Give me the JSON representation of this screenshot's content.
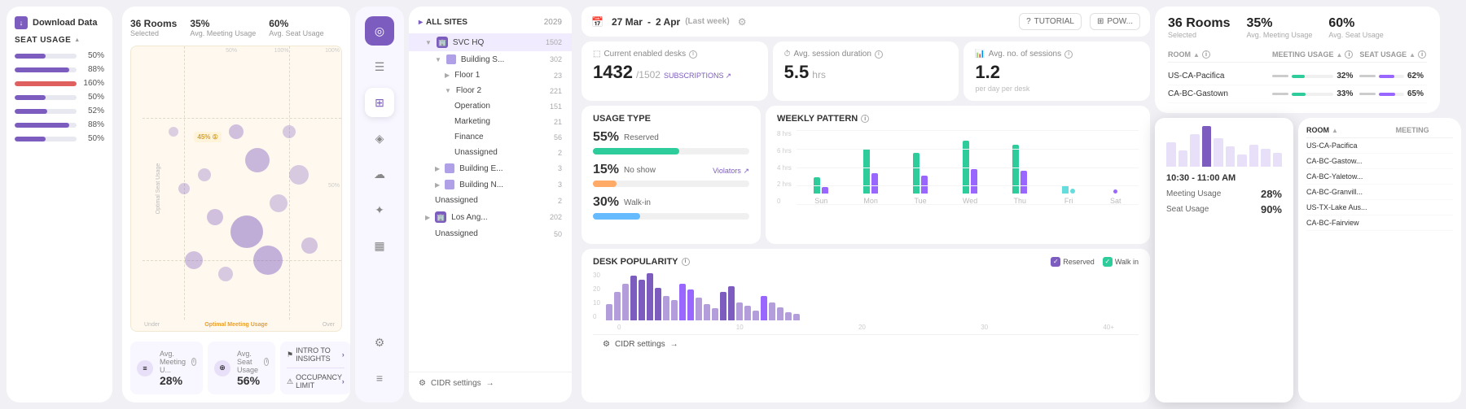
{
  "left_panel": {
    "download_label": "Download Data",
    "seat_usage_label": "SEAT USAGE",
    "usage_rows": [
      {
        "pct": "50%",
        "fill": 50
      },
      {
        "pct": "88%",
        "fill": 88
      },
      {
        "pct": "160%",
        "fill": 100
      },
      {
        "pct": "50%",
        "fill": 50
      },
      {
        "pct": "52%",
        "fill": 52
      },
      {
        "pct": "88%",
        "fill": 88
      },
      {
        "pct": "50%",
        "fill": 50
      }
    ],
    "avg_meeting_label": "Avg. Meeting U...",
    "avg_meeting_value": "28%",
    "avg_seat_label": "Avg. Seat Usage",
    "avg_seat_value": "56%",
    "intro_label": "INTRO TO INSIGHTS",
    "occupancy_label": "OCCUPANCY LIMIT",
    "chart_header": {
      "rooms": "36 Rooms",
      "room_sublabel": "Selected",
      "avg_meeting": "35%",
      "avg_meeting_label": "Avg. Meeting Usage",
      "avg_seat": "60%",
      "avg_seat_label": "Avg. Seat Usage"
    }
  },
  "sidebar": {
    "icons": [
      "◎",
      "☰",
      "⊞",
      "♦",
      "☁",
      "⚙",
      "✦",
      "☰",
      "⚙",
      "≡"
    ]
  },
  "tree": {
    "header": "ALL SITES",
    "year": "2029",
    "items": [
      {
        "name": "SVC HQ",
        "count": "1502",
        "level": 1,
        "expanded": true,
        "active": true
      },
      {
        "name": "Building S...",
        "count": "302",
        "level": 2,
        "expanded": true
      },
      {
        "name": "Floor 1",
        "count": "23",
        "level": 3
      },
      {
        "name": "Floor 2",
        "count": "221",
        "level": 3,
        "expanded": true
      },
      {
        "name": "Operation",
        "count": "151",
        "level": 4
      },
      {
        "name": "Marketing",
        "count": "21",
        "level": 4
      },
      {
        "name": "Finance",
        "count": "56",
        "level": 4
      },
      {
        "name": "Unassigned",
        "count": "2",
        "level": 4
      },
      {
        "name": "Building E...",
        "count": "3",
        "level": 2
      },
      {
        "name": "Building N...",
        "count": "3",
        "level": 2
      },
      {
        "name": "Unassigned",
        "count": "2",
        "level": 2
      },
      {
        "name": "Los Ang...",
        "count": "202",
        "level": 1,
        "expanded": false
      },
      {
        "name": "Unassigned",
        "count": "50",
        "level": 2
      }
    ],
    "settings_label": "CIDR settings",
    "arrow": "→"
  },
  "main": {
    "date_from": "27 Mar",
    "date_to": "2 Apr",
    "date_label": "(Last week)",
    "tutorial_label": "TUTORIAL",
    "pow_label": "POW...",
    "enabled_desks_label": "Current enabled desks",
    "enabled_desks_value": "1432",
    "enabled_desks_unit": "/1502",
    "subscriptions_label": "SUBSCRIPTIONS",
    "avg_session_label": "Avg. session duration",
    "avg_session_value": "5.5",
    "avg_session_unit": "hrs",
    "avg_sessions_label": "Avg. no. of sessions",
    "avg_sessions_value": "1.2",
    "avg_sessions_sub": "per day per desk",
    "usage_type_title": "USAGE TYPE",
    "usage_reserved_pct": "55",
    "usage_reserved_label": "Reserved",
    "usage_noshow_pct": "15",
    "usage_noshow_label": "No show",
    "usage_walkin_pct": "30",
    "usage_walkin_label": "Walk-in",
    "violators_label": "Violators",
    "weekly_pattern_title": "WEEKLY PATTERN",
    "week_days": [
      "Sun",
      "Mon",
      "Tue",
      "Wed",
      "Thu",
      "Fri",
      "Sat"
    ],
    "desk_popularity_title": "DESK POPULARITY",
    "legend_reserved": "Reserved",
    "legend_walkin": "Walk in",
    "cidr_label": "CIDR settings",
    "cidr_arrow": "→",
    "yaxis_labels": [
      "8 hrs",
      "6 hrs",
      "4 hrs",
      "2 hrs",
      "0"
    ]
  },
  "right": {
    "rooms_label": "36 Rooms",
    "rooms_sublabel": "Selected",
    "meeting_pct": "35%",
    "meeting_label": "Avg. Meeting Usage",
    "seat_pct": "60%",
    "seat_label": "Avg. Seat Usage",
    "col_room": "ROOM",
    "col_meeting": "MEETING USAGE",
    "col_seat": "SEAT USAGE",
    "rows": [
      {
        "room": "US-CA-Pacifica",
        "meeting": "32%",
        "meeting_fill": 32,
        "seat": "62%",
        "seat_fill": 62
      },
      {
        "room": "CA-BC-Gastown",
        "meeting": "33%",
        "meeting_fill": 33,
        "seat": "65%",
        "seat_fill": 65
      }
    ],
    "tooltip": {
      "time": "10:30 - 11:00 AM",
      "meeting_label": "Meeting Usage",
      "meeting_value": "28%",
      "seat_label": "Seat Usage",
      "seat_value": "90%"
    },
    "table2_col_room": "ROOM",
    "table2_col_meeting": "MEETING",
    "table2_rows": [
      {
        "room": "US-CA-Pacifica",
        "meeting": ""
      },
      {
        "room": "CA-BC-Gastow...",
        "meeting": ""
      },
      {
        "room": "CA-BC-Yaletow...",
        "meeting": ""
      },
      {
        "room": "CA-BC-Granvill...",
        "meeting": ""
      },
      {
        "room": "US-TX-Lake Aus...",
        "meeting": ""
      },
      {
        "room": "CA-BC-Fairview",
        "meeting": ""
      }
    ]
  }
}
